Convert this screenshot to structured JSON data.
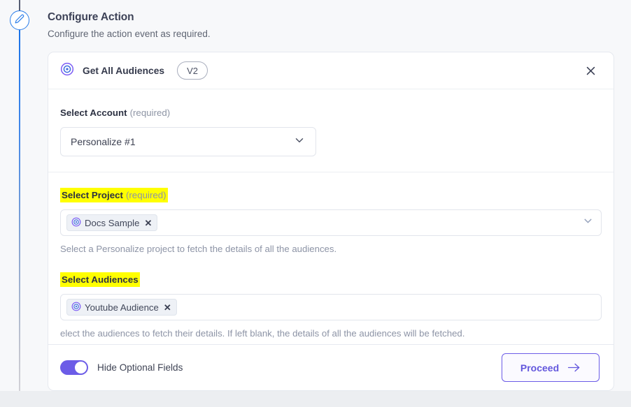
{
  "header": {
    "title": "Configure Action",
    "subtitle": "Configure the action event as required."
  },
  "rail": {
    "node_icon": "pencil-edit-icon",
    "line_color_top": "#565e73",
    "line_color_bottom": "#1b73e8"
  },
  "card": {
    "action_icon": "bullseye-target-icon",
    "action_title": "Get All Audiences",
    "version_badge": "V2",
    "close_icon": "close-x-icon"
  },
  "fields": {
    "account": {
      "label": "Select Account",
      "required_text": "(required)",
      "value": "Personalize #1",
      "chevron_icon": "chevron-down-icon"
    },
    "project": {
      "label": "Select Project",
      "required_text": "(required)",
      "highlighted": true,
      "highlight_color": "#ffff00",
      "chips": [
        {
          "icon": "bullseye-target-icon",
          "label": "Docs Sample",
          "remove_icon": "close-x-icon"
        }
      ],
      "helper": "Select a Personalize project to fetch the details of all the audiences.",
      "chevron_icon": "chevron-down-icon"
    },
    "audiences": {
      "label": "Select Audiences",
      "required_text": "",
      "highlighted": true,
      "highlight_color": "#ffff00",
      "chips": [
        {
          "icon": "bullseye-target-icon",
          "label": "Youtube Audience",
          "remove_icon": "close-x-icon"
        }
      ],
      "helper": "elect the audiences to fetch their details. If left blank, the details of all the audiences will be fetched."
    }
  },
  "footer": {
    "toggle_label": "Hide Optional Fields",
    "toggle_on": true,
    "toggle_color": "#6c5ce7",
    "proceed_label": "Proceed",
    "proceed_arrow_icon": "arrow-right-icon",
    "accent_color": "#6c5ce7"
  }
}
